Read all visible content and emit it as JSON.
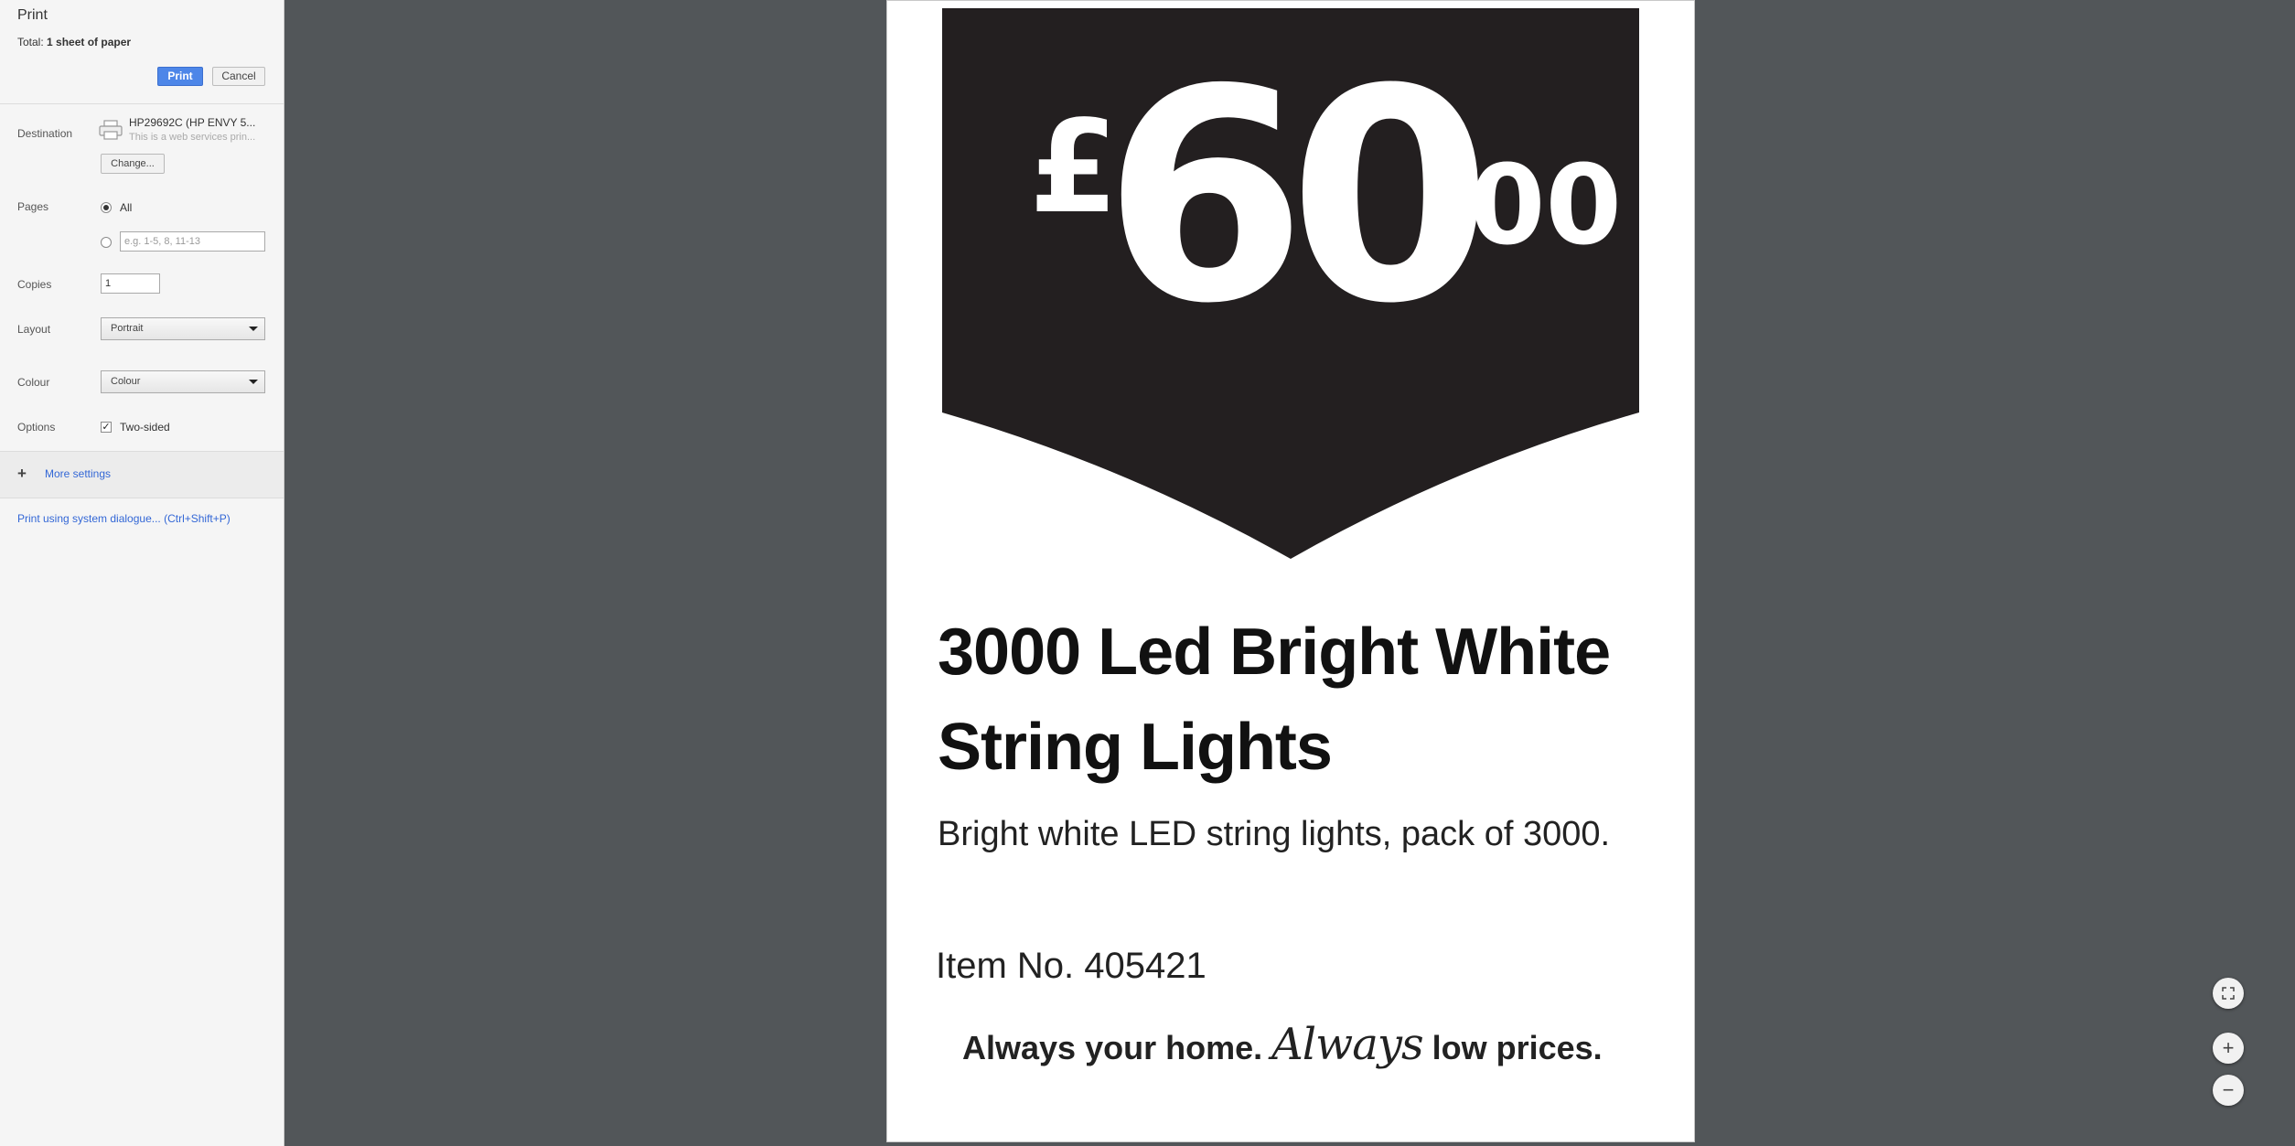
{
  "sidebar": {
    "title": "Print",
    "summary_prefix": "Total: ",
    "summary_value": "1 sheet of paper",
    "print_label": "Print",
    "cancel_label": "Cancel",
    "destination": {
      "label": "Destination",
      "printer_name": "HP29692C (HP ENVY 5...",
      "printer_sub": "This is a web services prin...",
      "change_label": "Change..."
    },
    "pages": {
      "label": "Pages",
      "all_label": "All",
      "custom_placeholder": "e.g. 1-5, 8, 11-13"
    },
    "copies": {
      "label": "Copies",
      "value": "1"
    },
    "layout": {
      "label": "Layout",
      "value": "Portrait"
    },
    "colour": {
      "label": "Colour",
      "value": "Colour"
    },
    "options": {
      "label": "Options",
      "two_sided_label": "Two-sided",
      "two_sided_checked": true
    },
    "more_settings": "More settings",
    "system_dialog": "Print using system dialogue... (Ctrl+Shift+P)"
  },
  "preview": {
    "price_currency": "£",
    "price_main": "60",
    "price_fraction": "00",
    "product_title": "3000 Led Bright White String Lights",
    "description": "Bright white LED string lights, pack of 3000.",
    "item_number": "Item No. 405421",
    "slogan_part1": "Always your home.",
    "slogan_script": "Always",
    "slogan_part2": "low prices."
  },
  "zoom_controls": {
    "fit_icon": "fit-to-page-icon",
    "zoom_in_icon": "zoom-in-icon",
    "zoom_out_icon": "zoom-out-icon"
  },
  "colors": {
    "accent_button": "#4d86e8",
    "link": "#3367d6",
    "viewer_background": "#525659",
    "price_tag": "#231f20"
  }
}
